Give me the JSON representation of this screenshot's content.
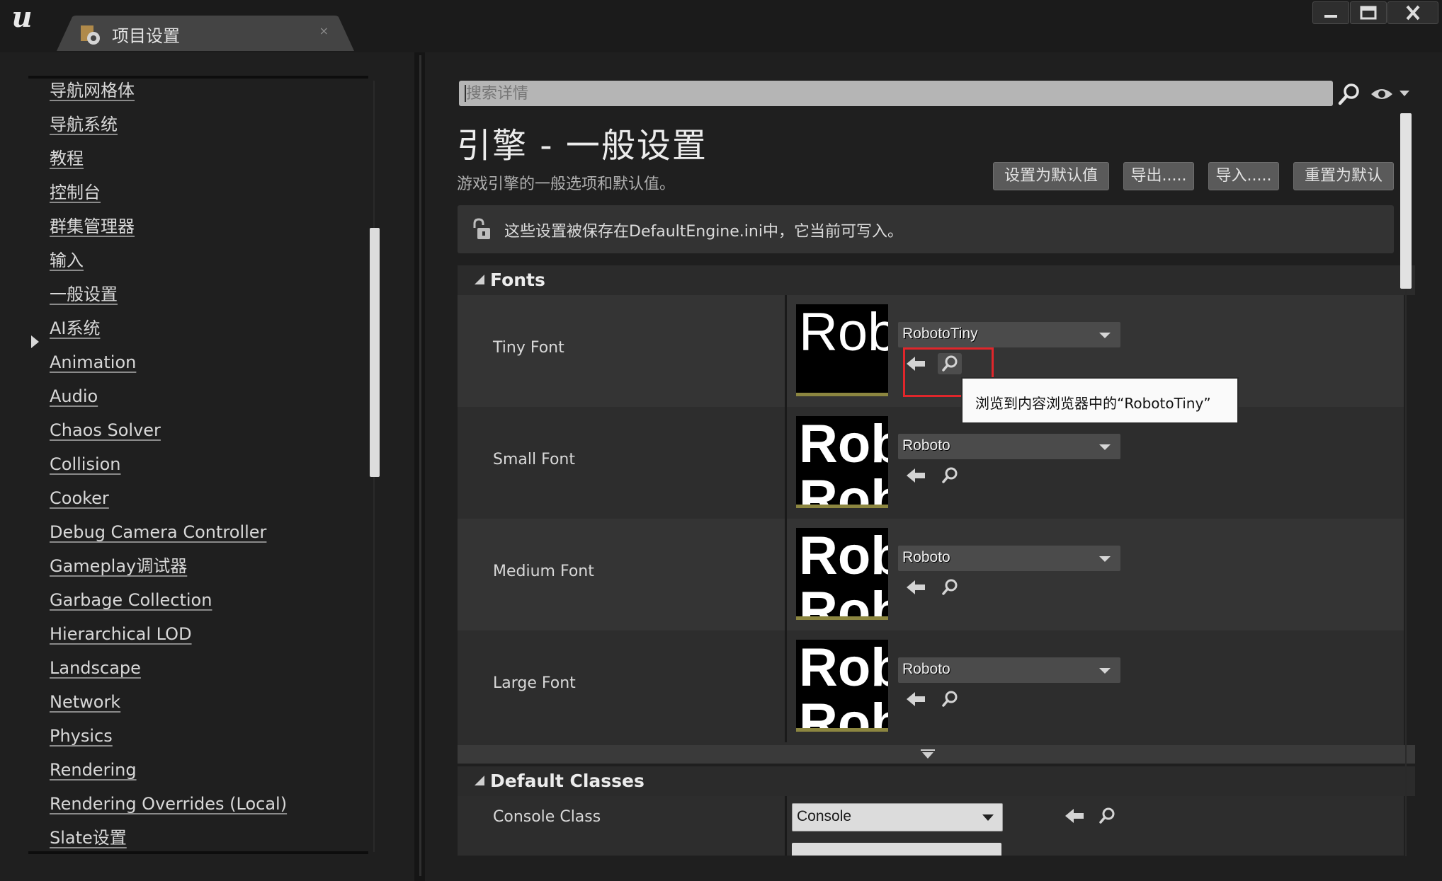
{
  "window": {
    "tab_title": "项目设置",
    "tab_close": "×",
    "controls": {
      "minimize": "minimize",
      "maximize": "maximize",
      "close": "close"
    }
  },
  "sidebar": {
    "items": [
      {
        "label": "导航网格体"
      },
      {
        "label": "导航系统"
      },
      {
        "label": "教程"
      },
      {
        "label": "控制台"
      },
      {
        "label": "群集管理器"
      },
      {
        "label": "输入"
      },
      {
        "label": "一般设置",
        "selected": true
      },
      {
        "label": "AI系统"
      },
      {
        "label": "Animation"
      },
      {
        "label": "Audio"
      },
      {
        "label": "Chaos Solver"
      },
      {
        "label": "Collision"
      },
      {
        "label": "Cooker"
      },
      {
        "label": "Debug Camera Controller"
      },
      {
        "label": "Gameplay调试器"
      },
      {
        "label": "Garbage Collection"
      },
      {
        "label": "Hierarchical LOD"
      },
      {
        "label": "Landscape"
      },
      {
        "label": "Network"
      },
      {
        "label": "Physics"
      },
      {
        "label": "Rendering"
      },
      {
        "label": "Rendering Overrides (Local)"
      },
      {
        "label": "Slate设置"
      }
    ]
  },
  "search": {
    "placeholder": "搜索详情",
    "value": ""
  },
  "header": {
    "title": "引擎 - 一般设置",
    "subtitle": "游戏引擎的一般选项和默认值。"
  },
  "actions": {
    "set_default": "设置为默认值",
    "export": "导出.....",
    "import": "导入.....",
    "reset": "重置为默认"
  },
  "notice": {
    "text": "这些设置被保存在DefaultEngine.ini中，它当前可写入。"
  },
  "fonts_section": {
    "title": "Fonts",
    "rows": [
      {
        "label": "Tiny Font",
        "value": "RobotoTiny",
        "preview": "Rob"
      },
      {
        "label": "Small Font",
        "value": "Roboto",
        "preview": "Rob"
      },
      {
        "label": "Medium Font",
        "value": "Roboto",
        "preview": "Rob"
      },
      {
        "label": "Large Font",
        "value": "Roboto",
        "preview": "Rob"
      }
    ]
  },
  "tooltip": {
    "text": "浏览到内容浏览器中的“RobotoTiny”"
  },
  "classes_section": {
    "title": "Default Classes",
    "rows": [
      {
        "label": "Console Class",
        "value": "Console"
      }
    ]
  },
  "colors": {
    "highlight_box": "#e0262b",
    "panel": "#1f1f1f",
    "row": "#2d2d2d",
    "row_alt": "#343434"
  }
}
